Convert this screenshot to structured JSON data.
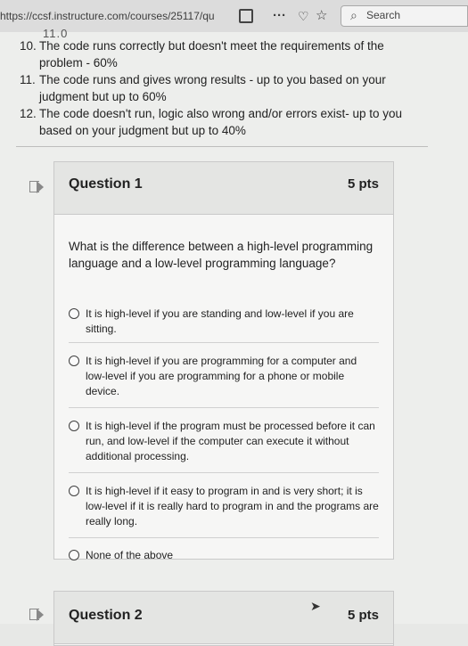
{
  "browser": {
    "url": "https://ccsf.instructure.com/courses/25117/qu",
    "search_placeholder": "Search",
    "more_label": "···"
  },
  "page": {
    "cut_text": "11.0",
    "rubric": [
      {
        "num": "10.",
        "text": "The code runs correctly but doesn't meet the requirements of the problem - 60%"
      },
      {
        "num": "11.",
        "text": "The code runs and gives wrong results - up to you based on your judgment but up to 60%"
      },
      {
        "num": "12.",
        "text": "The code doesn't run, logic also wrong and/or errors exist- up to you based on your judgment but up to 40%"
      }
    ]
  },
  "question1": {
    "title": "Question 1",
    "points": "5 pts",
    "text": "What is the difference between a high-level programming language and a low-level programming language?",
    "answers": [
      "It is high-level if you are standing and low-level if you are sitting.",
      "It is high-level if you are programming for a computer and low-level if you are programming for a phone or mobile device.",
      "It is high-level if the program must be processed before it can run, and low-level if the computer can execute it without additional processing.",
      "It is high-level if it easy to program in and is very short; it is low-level if it is really hard to program in and the programs are really long.",
      "None of the above"
    ]
  },
  "question2": {
    "title": "Question 2",
    "points": "5 pts"
  }
}
